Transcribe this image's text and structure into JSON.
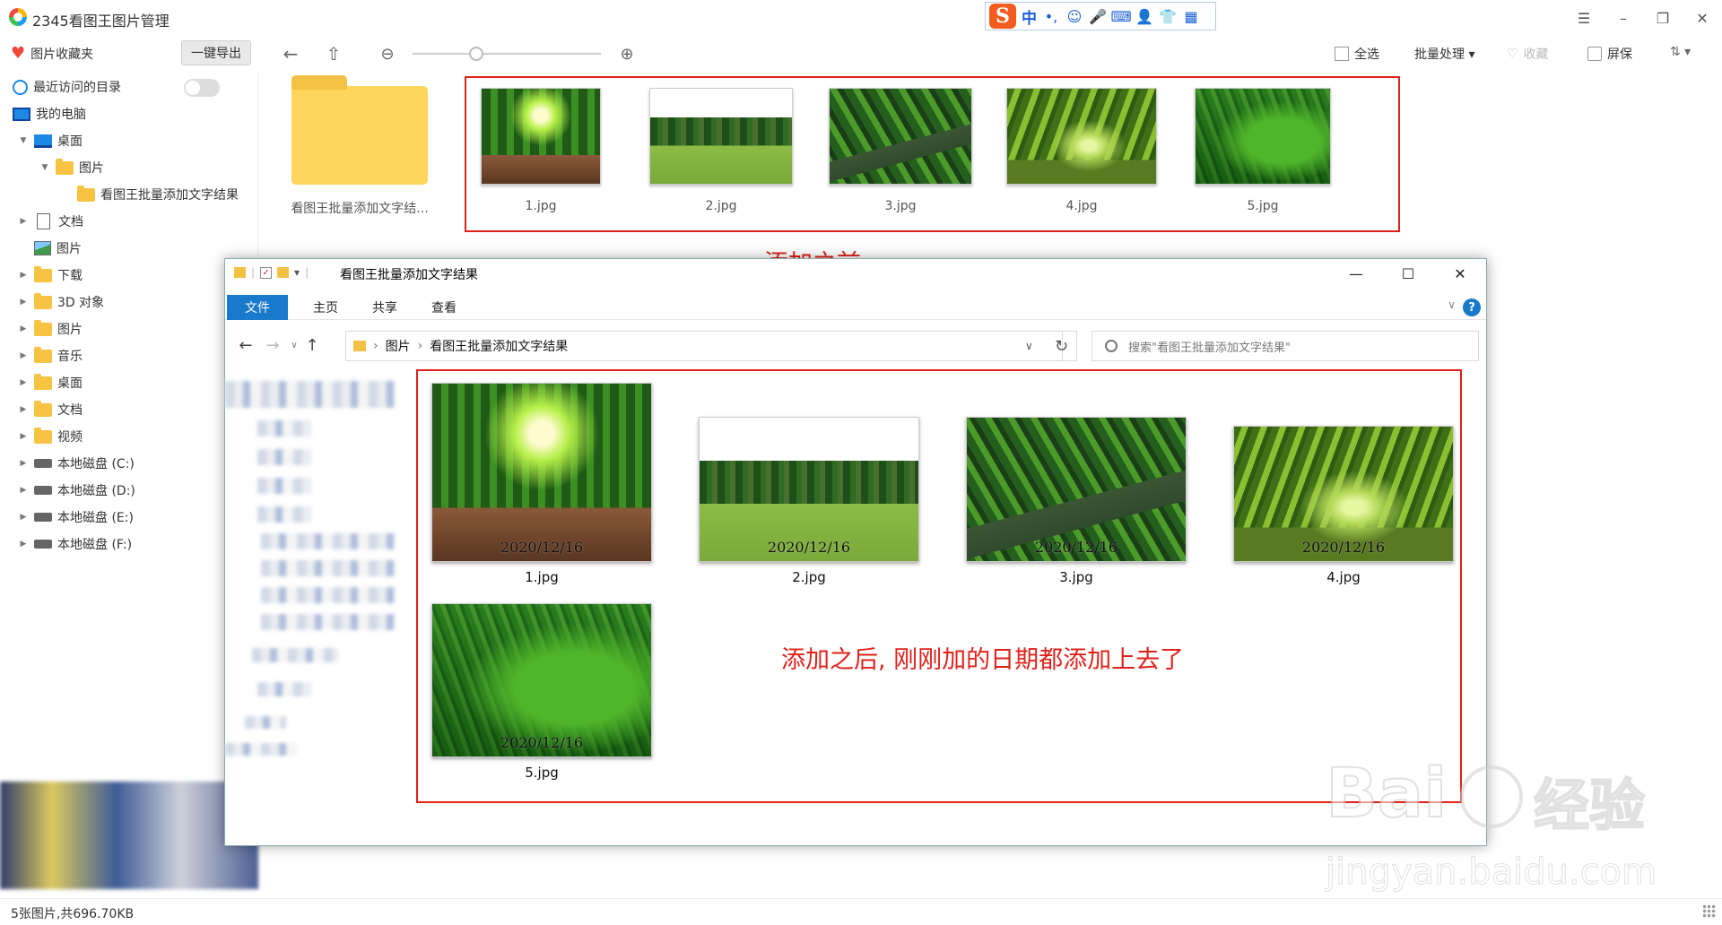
{
  "app": {
    "title": "2345看图王图片管理"
  },
  "window_controls": {
    "menu": "☰",
    "minimize": "–",
    "restore": "❐",
    "close": "✕"
  },
  "ime": {
    "brand": "S",
    "mode": "中",
    "punct": "•,",
    "emoji": "☺",
    "voice": "🎤",
    "keyboard": "⌨",
    "user": "👤",
    "skin": "👕",
    "apps": "▦"
  },
  "toolbar": {
    "favorites": "图片收藏夹",
    "export": "一键导出",
    "select_all": "全选",
    "batch": "批量处理 ▾",
    "collect": "收藏",
    "screen": "屏保",
    "sort": "⇅ ▾"
  },
  "sidebar": {
    "recent": "最近访问的目录",
    "my_computer": "我的电脑",
    "desktop": "桌面",
    "pictures": "图片",
    "result_folder": "看图王批量添加文字结果",
    "items": [
      "文档",
      "图片",
      "下载",
      "3D 对象",
      "图片",
      "音乐",
      "桌面",
      "文档",
      "视频"
    ],
    "drives": [
      "本地磁盘 (C:)",
      "本地磁盘 (D:)",
      "本地磁盘 (E:)",
      "本地磁盘 (F:)"
    ]
  },
  "gallery": {
    "folder_name": "看图王批量添加文字结...",
    "files": [
      "1.jpg",
      "2.jpg",
      "3.jpg",
      "4.jpg",
      "5.jpg"
    ]
  },
  "annotations": {
    "before": "添加之前",
    "after": "添加之后, 刚刚加的日期都添加上去了"
  },
  "explorer": {
    "title": "看图王批量添加文字结果",
    "tabs": [
      "文件",
      "主页",
      "共享",
      "查看"
    ],
    "breadcrumb": [
      "图片",
      "看图王批量添加文字结果"
    ],
    "search_placeholder": "搜索\"看图王批量添加文字结果\"",
    "date_stamp": "2020/12/16",
    "files": [
      "1.jpg",
      "2.jpg",
      "3.jpg",
      "4.jpg",
      "5.jpg"
    ]
  },
  "watermark": {
    "brand": "Bai",
    "brand_tail": "经验",
    "url": "jingyan.baidu.com"
  },
  "status": {
    "text": "5张图片,共696.70KB"
  }
}
